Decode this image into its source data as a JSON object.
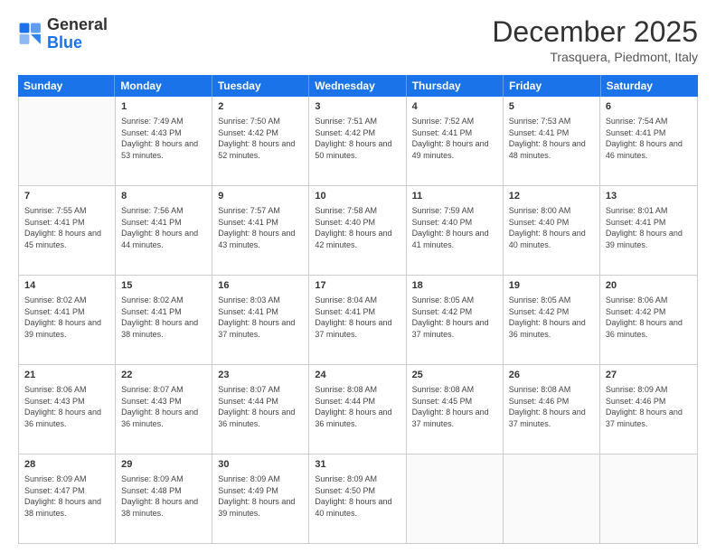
{
  "header": {
    "logo_general": "General",
    "logo_blue": "Blue",
    "month": "December 2025",
    "location": "Trasquera, Piedmont, Italy"
  },
  "calendar": {
    "days_of_week": [
      "Sunday",
      "Monday",
      "Tuesday",
      "Wednesday",
      "Thursday",
      "Friday",
      "Saturday"
    ],
    "rows": [
      [
        {
          "day": "",
          "sunrise": "",
          "sunset": "",
          "daylight": ""
        },
        {
          "day": "1",
          "sunrise": "Sunrise: 7:49 AM",
          "sunset": "Sunset: 4:43 PM",
          "daylight": "Daylight: 8 hours and 53 minutes."
        },
        {
          "day": "2",
          "sunrise": "Sunrise: 7:50 AM",
          "sunset": "Sunset: 4:42 PM",
          "daylight": "Daylight: 8 hours and 52 minutes."
        },
        {
          "day": "3",
          "sunrise": "Sunrise: 7:51 AM",
          "sunset": "Sunset: 4:42 PM",
          "daylight": "Daylight: 8 hours and 50 minutes."
        },
        {
          "day": "4",
          "sunrise": "Sunrise: 7:52 AM",
          "sunset": "Sunset: 4:41 PM",
          "daylight": "Daylight: 8 hours and 49 minutes."
        },
        {
          "day": "5",
          "sunrise": "Sunrise: 7:53 AM",
          "sunset": "Sunset: 4:41 PM",
          "daylight": "Daylight: 8 hours and 48 minutes."
        },
        {
          "day": "6",
          "sunrise": "Sunrise: 7:54 AM",
          "sunset": "Sunset: 4:41 PM",
          "daylight": "Daylight: 8 hours and 46 minutes."
        }
      ],
      [
        {
          "day": "7",
          "sunrise": "Sunrise: 7:55 AM",
          "sunset": "Sunset: 4:41 PM",
          "daylight": "Daylight: 8 hours and 45 minutes."
        },
        {
          "day": "8",
          "sunrise": "Sunrise: 7:56 AM",
          "sunset": "Sunset: 4:41 PM",
          "daylight": "Daylight: 8 hours and 44 minutes."
        },
        {
          "day": "9",
          "sunrise": "Sunrise: 7:57 AM",
          "sunset": "Sunset: 4:41 PM",
          "daylight": "Daylight: 8 hours and 43 minutes."
        },
        {
          "day": "10",
          "sunrise": "Sunrise: 7:58 AM",
          "sunset": "Sunset: 4:40 PM",
          "daylight": "Daylight: 8 hours and 42 minutes."
        },
        {
          "day": "11",
          "sunrise": "Sunrise: 7:59 AM",
          "sunset": "Sunset: 4:40 PM",
          "daylight": "Daylight: 8 hours and 41 minutes."
        },
        {
          "day": "12",
          "sunrise": "Sunrise: 8:00 AM",
          "sunset": "Sunset: 4:40 PM",
          "daylight": "Daylight: 8 hours and 40 minutes."
        },
        {
          "day": "13",
          "sunrise": "Sunrise: 8:01 AM",
          "sunset": "Sunset: 4:41 PM",
          "daylight": "Daylight: 8 hours and 39 minutes."
        }
      ],
      [
        {
          "day": "14",
          "sunrise": "Sunrise: 8:02 AM",
          "sunset": "Sunset: 4:41 PM",
          "daylight": "Daylight: 8 hours and 39 minutes."
        },
        {
          "day": "15",
          "sunrise": "Sunrise: 8:02 AM",
          "sunset": "Sunset: 4:41 PM",
          "daylight": "Daylight: 8 hours and 38 minutes."
        },
        {
          "day": "16",
          "sunrise": "Sunrise: 8:03 AM",
          "sunset": "Sunset: 4:41 PM",
          "daylight": "Daylight: 8 hours and 37 minutes."
        },
        {
          "day": "17",
          "sunrise": "Sunrise: 8:04 AM",
          "sunset": "Sunset: 4:41 PM",
          "daylight": "Daylight: 8 hours and 37 minutes."
        },
        {
          "day": "18",
          "sunrise": "Sunrise: 8:05 AM",
          "sunset": "Sunset: 4:42 PM",
          "daylight": "Daylight: 8 hours and 37 minutes."
        },
        {
          "day": "19",
          "sunrise": "Sunrise: 8:05 AM",
          "sunset": "Sunset: 4:42 PM",
          "daylight": "Daylight: 8 hours and 36 minutes."
        },
        {
          "day": "20",
          "sunrise": "Sunrise: 8:06 AM",
          "sunset": "Sunset: 4:42 PM",
          "daylight": "Daylight: 8 hours and 36 minutes."
        }
      ],
      [
        {
          "day": "21",
          "sunrise": "Sunrise: 8:06 AM",
          "sunset": "Sunset: 4:43 PM",
          "daylight": "Daylight: 8 hours and 36 minutes."
        },
        {
          "day": "22",
          "sunrise": "Sunrise: 8:07 AM",
          "sunset": "Sunset: 4:43 PM",
          "daylight": "Daylight: 8 hours and 36 minutes."
        },
        {
          "day": "23",
          "sunrise": "Sunrise: 8:07 AM",
          "sunset": "Sunset: 4:44 PM",
          "daylight": "Daylight: 8 hours and 36 minutes."
        },
        {
          "day": "24",
          "sunrise": "Sunrise: 8:08 AM",
          "sunset": "Sunset: 4:44 PM",
          "daylight": "Daylight: 8 hours and 36 minutes."
        },
        {
          "day": "25",
          "sunrise": "Sunrise: 8:08 AM",
          "sunset": "Sunset: 4:45 PM",
          "daylight": "Daylight: 8 hours and 37 minutes."
        },
        {
          "day": "26",
          "sunrise": "Sunrise: 8:08 AM",
          "sunset": "Sunset: 4:46 PM",
          "daylight": "Daylight: 8 hours and 37 minutes."
        },
        {
          "day": "27",
          "sunrise": "Sunrise: 8:09 AM",
          "sunset": "Sunset: 4:46 PM",
          "daylight": "Daylight: 8 hours and 37 minutes."
        }
      ],
      [
        {
          "day": "28",
          "sunrise": "Sunrise: 8:09 AM",
          "sunset": "Sunset: 4:47 PM",
          "daylight": "Daylight: 8 hours and 38 minutes."
        },
        {
          "day": "29",
          "sunrise": "Sunrise: 8:09 AM",
          "sunset": "Sunset: 4:48 PM",
          "daylight": "Daylight: 8 hours and 38 minutes."
        },
        {
          "day": "30",
          "sunrise": "Sunrise: 8:09 AM",
          "sunset": "Sunset: 4:49 PM",
          "daylight": "Daylight: 8 hours and 39 minutes."
        },
        {
          "day": "31",
          "sunrise": "Sunrise: 8:09 AM",
          "sunset": "Sunset: 4:50 PM",
          "daylight": "Daylight: 8 hours and 40 minutes."
        },
        {
          "day": "",
          "sunrise": "",
          "sunset": "",
          "daylight": ""
        },
        {
          "day": "",
          "sunrise": "",
          "sunset": "",
          "daylight": ""
        },
        {
          "day": "",
          "sunrise": "",
          "sunset": "",
          "daylight": ""
        }
      ]
    ]
  }
}
